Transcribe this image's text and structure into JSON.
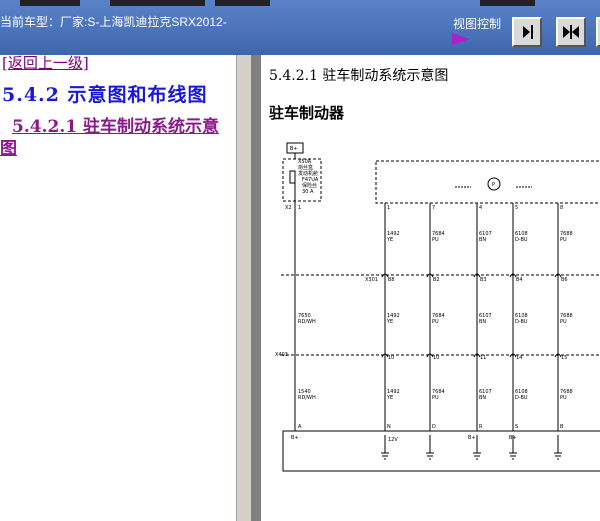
{
  "header": {
    "vehicle_label": "当前车型：厂家:S-上海凯迪拉克SRX2012-",
    "view_control_label": "视图控制",
    "buttons": [
      {
        "name": "next-page-icon"
      },
      {
        "name": "split-view-icon"
      }
    ]
  },
  "sidebar": {
    "back_link": "[返回上一级]",
    "section_heading": "5.4.2 示意图和布线图",
    "sub_link": "5.4.2.1 驻车制动系统示意图"
  },
  "content": {
    "section_title": "5.4.2.1 驻车制动系统示意图",
    "subtitle": "驻车制动器",
    "diagram": {
      "power_label": "B+",
      "fuse_block": [
        "X50A",
        "熔丝盒",
        "发动机舱",
        "F47UA",
        "保险丝",
        "30 A"
      ],
      "fuse_connector_left": "X2",
      "fuse_connector_pin": "1",
      "connector_x301": "X301",
      "connector_x403": "X403",
      "left_wire": {
        "top": [
          "7650",
          "RD/WH"
        ],
        "mid": [
          "1540",
          "RD/WH"
        ]
      },
      "module_pins_top": [
        "1",
        "7",
        "4",
        "5",
        "8"
      ],
      "columns": [
        {
          "wire_top": [
            "1492",
            "YE"
          ],
          "x301_pin": "B8",
          "wire_mid": [
            "1492",
            "YE"
          ],
          "x403_pin": "10",
          "wire_bot": [
            "1492",
            "YE"
          ],
          "module_pin": "N"
        },
        {
          "wire_top": [
            "7684",
            "PU"
          ],
          "x301_pin": "B2",
          "wire_mid": [
            "7684",
            "PU"
          ],
          "x403_pin": "10",
          "wire_bot": [
            "7684",
            "PU"
          ],
          "module_pin": "D"
        },
        {
          "wire_top": [
            "6107",
            "BN"
          ],
          "x301_pin": "B3",
          "wire_mid": [
            "6107",
            "BN"
          ],
          "x403_pin": "11",
          "wire_bot": [
            "6107",
            "BN"
          ],
          "module_pin": "R"
        },
        {
          "wire_top": [
            "6108",
            "D-BU"
          ],
          "x301_pin": "B4",
          "wire_mid": [
            "6108",
            "D-BU"
          ],
          "x403_pin": "14",
          "wire_bot": [
            "6108",
            "D-BU"
          ],
          "module_pin": "S"
        },
        {
          "wire_top": [
            "7688",
            "PU"
          ],
          "x301_pin": "B6",
          "wire_mid": [
            "7688",
            "PU"
          ],
          "x403_pin": "15",
          "wire_bot": [
            "7688",
            "PU"
          ],
          "module_pin": "B"
        }
      ],
      "left_pins": [
        "1",
        "A"
      ],
      "module_labels": [
        "B+",
        "12V",
        "B+",
        "B+"
      ]
    }
  },
  "colors": {
    "topbar": "#4a72ba",
    "heading": "#1818d8",
    "visited_link": "#800080",
    "play_icon": "#b01ec8"
  }
}
